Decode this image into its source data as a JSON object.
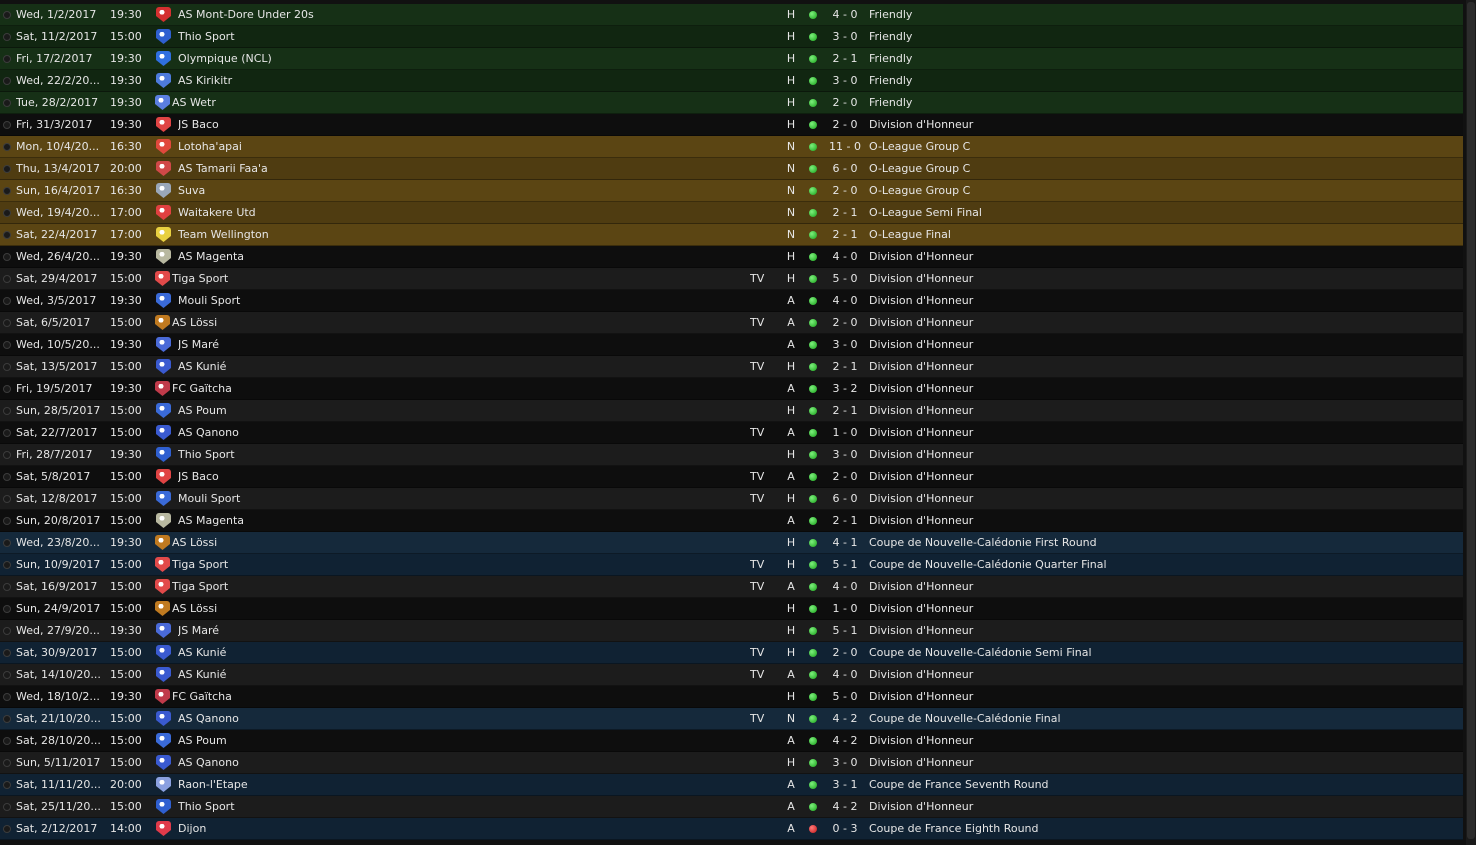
{
  "fixtures": [
    {
      "date": "Wed, 1/2/2017",
      "time": "19:30",
      "opponent": "AS Mont-Dore Under 20s",
      "crest_icon": "club-crest-icon",
      "tv": "",
      "venue": "H",
      "result": "win",
      "score": "4 - 0",
      "competition": "Friendly",
      "category": "friendly"
    },
    {
      "date": "Sat, 11/2/2017",
      "time": "15:00",
      "opponent": "Thio Sport",
      "crest_icon": "club-crest-icon",
      "tv": "",
      "venue": "H",
      "result": "win",
      "score": "3 - 0",
      "competition": "Friendly",
      "category": "friendly"
    },
    {
      "date": "Fri, 17/2/2017",
      "time": "19:30",
      "opponent": "Olympique (NCL)",
      "crest_icon": "club-crest-icon",
      "tv": "",
      "venue": "H",
      "result": "win",
      "score": "2 - 1",
      "competition": "Friendly",
      "category": "friendly"
    },
    {
      "date": "Wed, 22/2/20...",
      "time": "19:30",
      "opponent": "AS Kirikitr",
      "crest_icon": "club-crest-icon",
      "tv": "",
      "venue": "H",
      "result": "win",
      "score": "3 - 0",
      "competition": "Friendly",
      "category": "friendly"
    },
    {
      "date": "Tue, 28/2/2017",
      "time": "19:30",
      "opponent": "AS Wetr",
      "crest_icon": "club-crest-icon",
      "tv": "",
      "venue": "H",
      "result": "win",
      "score": "2 - 0",
      "competition": "Friendly",
      "category": "friendly"
    },
    {
      "date": "Fri, 31/3/2017",
      "time": "19:30",
      "opponent": "JS Baco",
      "crest_icon": "club-crest-icon",
      "tv": "",
      "venue": "H",
      "result": "win",
      "score": "2 - 0",
      "competition": "Division d'Honneur",
      "category": "league"
    },
    {
      "date": "Mon, 10/4/20...",
      "time": "16:30",
      "opponent": "Lotoha'apai",
      "crest_icon": "club-crest-icon",
      "tv": "",
      "venue": "N",
      "result": "win",
      "score": "11 - 0",
      "competition": "O-League Group C",
      "category": "oleague"
    },
    {
      "date": "Thu, 13/4/2017",
      "time": "20:00",
      "opponent": "AS Tamarii Faa'a",
      "crest_icon": "club-crest-icon",
      "tv": "",
      "venue": "N",
      "result": "win",
      "score": "6 - 0",
      "competition": "O-League Group C",
      "category": "oleague"
    },
    {
      "date": "Sun, 16/4/2017",
      "time": "16:30",
      "opponent": "Suva",
      "crest_icon": "club-crest-icon",
      "tv": "",
      "venue": "N",
      "result": "win",
      "score": "2 - 0",
      "competition": "O-League Group C",
      "category": "oleague"
    },
    {
      "date": "Wed, 19/4/20...",
      "time": "17:00",
      "opponent": "Waitakere Utd",
      "crest_icon": "club-crest-icon",
      "tv": "",
      "venue": "N",
      "result": "win",
      "score": "2 - 1",
      "competition": "O-League Semi Final",
      "category": "oleague"
    },
    {
      "date": "Sat, 22/4/2017",
      "time": "17:00",
      "opponent": "Team Wellington",
      "crest_icon": "club-crest-icon",
      "tv": "",
      "venue": "N",
      "result": "win",
      "score": "2 - 1",
      "competition": "O-League Final",
      "category": "oleague"
    },
    {
      "date": "Wed, 26/4/20...",
      "time": "19:30",
      "opponent": "AS Magenta",
      "crest_icon": "club-crest-icon",
      "tv": "",
      "venue": "H",
      "result": "win",
      "score": "4 - 0",
      "competition": "Division d'Honneur",
      "category": "league"
    },
    {
      "date": "Sat, 29/4/2017",
      "time": "15:00",
      "opponent": "Tiga Sport",
      "crest_icon": "club-crest-icon",
      "tv": "TV",
      "venue": "H",
      "result": "win",
      "score": "5 - 0",
      "competition": "Division d'Honneur",
      "category": "league"
    },
    {
      "date": "Wed, 3/5/2017",
      "time": "19:30",
      "opponent": "Mouli Sport",
      "crest_icon": "club-crest-icon",
      "tv": "",
      "venue": "A",
      "result": "win",
      "score": "4 - 0",
      "competition": "Division d'Honneur",
      "category": "league"
    },
    {
      "date": "Sat, 6/5/2017",
      "time": "15:00",
      "opponent": "AS Lössi",
      "crest_icon": "club-crest-icon",
      "tv": "TV",
      "venue": "A",
      "result": "win",
      "score": "2 - 0",
      "competition": "Division d'Honneur",
      "category": "league"
    },
    {
      "date": "Wed, 10/5/20...",
      "time": "19:30",
      "opponent": "JS Maré",
      "crest_icon": "club-crest-icon",
      "tv": "",
      "venue": "A",
      "result": "win",
      "score": "3 - 0",
      "competition": "Division d'Honneur",
      "category": "league"
    },
    {
      "date": "Sat, 13/5/2017",
      "time": "15:00",
      "opponent": "AS Kunié",
      "crest_icon": "club-crest-icon",
      "tv": "TV",
      "venue": "H",
      "result": "win",
      "score": "2 - 1",
      "competition": "Division d'Honneur",
      "category": "league"
    },
    {
      "date": "Fri, 19/5/2017",
      "time": "19:30",
      "opponent": "FC Gaïtcha",
      "crest_icon": "club-crest-icon",
      "tv": "",
      "venue": "A",
      "result": "win",
      "score": "3 - 2",
      "competition": "Division d'Honneur",
      "category": "league"
    },
    {
      "date": "Sun, 28/5/2017",
      "time": "15:00",
      "opponent": "AS Poum",
      "crest_icon": "club-crest-icon",
      "tv": "",
      "venue": "H",
      "result": "win",
      "score": "2 - 1",
      "competition": "Division d'Honneur",
      "category": "league"
    },
    {
      "date": "Sat, 22/7/2017",
      "time": "15:00",
      "opponent": "AS Qanono",
      "crest_icon": "club-crest-icon",
      "tv": "TV",
      "venue": "A",
      "result": "win",
      "score": "1 - 0",
      "competition": "Division d'Honneur",
      "category": "league"
    },
    {
      "date": "Fri, 28/7/2017",
      "time": "19:30",
      "opponent": "Thio Sport",
      "crest_icon": "club-crest-icon",
      "tv": "",
      "venue": "H",
      "result": "win",
      "score": "3 - 0",
      "competition": "Division d'Honneur",
      "category": "league"
    },
    {
      "date": "Sat, 5/8/2017",
      "time": "15:00",
      "opponent": "JS Baco",
      "crest_icon": "club-crest-icon",
      "tv": "TV",
      "venue": "A",
      "result": "win",
      "score": "2 - 0",
      "competition": "Division d'Honneur",
      "category": "league"
    },
    {
      "date": "Sat, 12/8/2017",
      "time": "15:00",
      "opponent": "Mouli Sport",
      "crest_icon": "club-crest-icon",
      "tv": "TV",
      "venue": "H",
      "result": "win",
      "score": "6 - 0",
      "competition": "Division d'Honneur",
      "category": "league"
    },
    {
      "date": "Sun, 20/8/2017",
      "time": "15:00",
      "opponent": "AS Magenta",
      "crest_icon": "club-crest-icon",
      "tv": "",
      "venue": "A",
      "result": "win",
      "score": "2 - 1",
      "competition": "Division d'Honneur",
      "category": "league"
    },
    {
      "date": "Wed, 23/8/20...",
      "time": "19:30",
      "opponent": "AS Lössi",
      "crest_icon": "club-crest-icon",
      "tv": "",
      "venue": "H",
      "result": "win",
      "score": "4 - 1",
      "competition": "Coupe de Nouvelle-Calédonie First Round",
      "category": "cup"
    },
    {
      "date": "Sun, 10/9/2017",
      "time": "15:00",
      "opponent": "Tiga Sport",
      "crest_icon": "club-crest-icon",
      "tv": "TV",
      "venue": "H",
      "result": "win",
      "score": "5 - 1",
      "competition": "Coupe de Nouvelle-Calédonie Quarter Final",
      "category": "cup"
    },
    {
      "date": "Sat, 16/9/2017",
      "time": "15:00",
      "opponent": "Tiga Sport",
      "crest_icon": "club-crest-icon",
      "tv": "TV",
      "venue": "A",
      "result": "win",
      "score": "4 - 0",
      "competition": "Division d'Honneur",
      "category": "league"
    },
    {
      "date": "Sun, 24/9/2017",
      "time": "15:00",
      "opponent": "AS Lössi",
      "crest_icon": "club-crest-icon",
      "tv": "",
      "venue": "H",
      "result": "win",
      "score": "1 - 0",
      "competition": "Division d'Honneur",
      "category": "league"
    },
    {
      "date": "Wed, 27/9/20...",
      "time": "19:30",
      "opponent": "JS Maré",
      "crest_icon": "club-crest-icon",
      "tv": "",
      "venue": "H",
      "result": "win",
      "score": "5 - 1",
      "competition": "Division d'Honneur",
      "category": "league"
    },
    {
      "date": "Sat, 30/9/2017",
      "time": "15:00",
      "opponent": "AS Kunié",
      "crest_icon": "club-crest-icon",
      "tv": "TV",
      "venue": "H",
      "result": "win",
      "score": "2 - 0",
      "competition": "Coupe de Nouvelle-Calédonie Semi Final",
      "category": "cup"
    },
    {
      "date": "Sat, 14/10/20...",
      "time": "15:00",
      "opponent": "AS Kunié",
      "crest_icon": "club-crest-icon",
      "tv": "TV",
      "venue": "A",
      "result": "win",
      "score": "4 - 0",
      "competition": "Division d'Honneur",
      "category": "league"
    },
    {
      "date": "Wed, 18/10/2...",
      "time": "19:30",
      "opponent": "FC Gaïtcha",
      "crest_icon": "club-crest-icon",
      "tv": "",
      "venue": "H",
      "result": "win",
      "score": "5 - 0",
      "competition": "Division d'Honneur",
      "category": "league"
    },
    {
      "date": "Sat, 21/10/20...",
      "time": "15:00",
      "opponent": "AS Qanono",
      "crest_icon": "club-crest-icon",
      "tv": "TV",
      "venue": "N",
      "result": "win",
      "score": "4 - 2",
      "competition": "Coupe de Nouvelle-Calédonie Final",
      "category": "cup"
    },
    {
      "date": "Sat, 28/10/20...",
      "time": "15:00",
      "opponent": "AS Poum",
      "crest_icon": "club-crest-icon",
      "tv": "",
      "venue": "A",
      "result": "win",
      "score": "4 - 2",
      "competition": "Division d'Honneur",
      "category": "league"
    },
    {
      "date": "Sun, 5/11/2017",
      "time": "15:00",
      "opponent": "AS Qanono",
      "crest_icon": "club-crest-icon",
      "tv": "",
      "venue": "H",
      "result": "win",
      "score": "3 - 0",
      "competition": "Division d'Honneur",
      "category": "league"
    },
    {
      "date": "Sat, 11/11/20...",
      "time": "20:00",
      "opponent": "Raon-l'Etape",
      "crest_icon": "club-crest-icon",
      "tv": "",
      "venue": "A",
      "result": "win",
      "score": "3 - 1",
      "competition": "Coupe de France Seventh Round",
      "category": "cup"
    },
    {
      "date": "Sat, 25/11/20...",
      "time": "15:00",
      "opponent": "Thio Sport",
      "crest_icon": "club-crest-icon",
      "tv": "",
      "venue": "A",
      "result": "win",
      "score": "4 - 2",
      "competition": "Division d'Honneur",
      "category": "league"
    },
    {
      "date": "Sat, 2/12/2017",
      "time": "14:00",
      "opponent": "Dijon",
      "crest_icon": "club-crest-icon",
      "tv": "",
      "venue": "A",
      "result": "loss",
      "score": "0 - 3",
      "competition": "Coupe de France Eighth Round",
      "category": "cup"
    }
  ],
  "colors": {
    "win": "#22b022",
    "loss": "#d01818",
    "friendly_row": "#163016",
    "league_row": "#1c1c1c",
    "oleague_row": "#5b4513",
    "cup_row": "#15293b"
  },
  "crest_colors": {
    "AS Mont-Dore Under 20s": "#d43030",
    "Thio Sport": "#2f5fd0",
    "Olympique (NCL)": "#2f6fe0",
    "AS Kirikitr": "#4d7bdc",
    "AS Wetr": "#5b7fe0",
    "JS Baco": "#e04444",
    "Lotoha'apai": "#e0483c",
    "AS Tamarii Faa'a": "#d04848",
    "Suva": "#9aa7b8",
    "Waitakere Utd": "#e04040",
    "Team Wellington": "#e8d040",
    "AS Magenta": "#b8b8a0",
    "Tiga Sport": "#e24a4a",
    "Mouli Sport": "#3a6ad8",
    "AS Lössi": "#c07a20",
    "JS Maré": "#4a6ad8",
    "AS Kunié": "#3a5ad0",
    "FC Gaïtcha": "#c03a4a",
    "AS Poum": "#3a6ad8",
    "AS Qanono": "#3a5ad0",
    "Raon-l'Etape": "#8aa0e0",
    "Dijon": "#e03a4a"
  }
}
